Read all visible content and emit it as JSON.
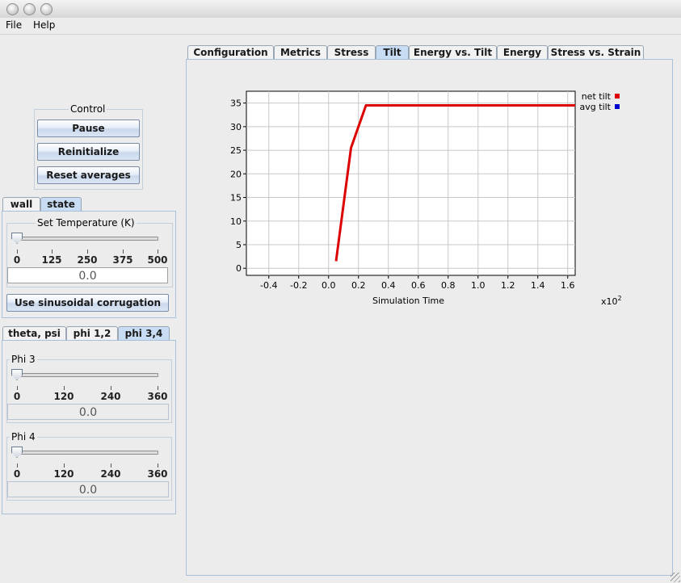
{
  "menu": [
    "File",
    "Help"
  ],
  "control": {
    "title": "Control",
    "pause": "Pause",
    "reinitialize": "Reinitialize",
    "reset_averages": "Reset averages"
  },
  "left_tabs": [
    "wall",
    "state"
  ],
  "state_panel": {
    "temp_title": "Set Temperature (K)",
    "temp_ticks": [
      "0",
      "125",
      "250",
      "375",
      "500"
    ],
    "temp_value": "0.0",
    "sinus_button": "Use sinusoidal corrugation"
  },
  "angle_tabs": [
    "theta, psi",
    "phi 1,2",
    "phi 3,4"
  ],
  "phi3": {
    "title": "Phi 3",
    "ticks": [
      "0",
      "120",
      "240",
      "360"
    ],
    "value": "0.0"
  },
  "phi4": {
    "title": "Phi 4",
    "ticks": [
      "0",
      "120",
      "240",
      "360"
    ],
    "value": "0.0"
  },
  "main_tabs": [
    "Configuration",
    "Metrics",
    "Stress",
    "Tilt",
    "Energy vs. Tilt",
    "Energy",
    "Stress vs. Strain"
  ],
  "chart_data": {
    "type": "line",
    "xlabel": "Simulation Time",
    "x_multiplier": "x10",
    "x_multiplier_exp": "2",
    "xlim": [
      -0.55,
      1.65
    ],
    "ylim": [
      -1.5,
      37.5
    ],
    "xticks": [
      -0.4,
      -0.2,
      0.0,
      0.2,
      0.4,
      0.6,
      0.8,
      1.0,
      1.2,
      1.4,
      1.6
    ],
    "xtick_labels": [
      "-0.4",
      "-0.2",
      "0.0",
      "0.2",
      "0.4",
      "0.6",
      "0.8",
      "1.0",
      "1.2",
      "1.4",
      "1.6"
    ],
    "yticks": [
      0,
      5,
      10,
      15,
      20,
      25,
      30,
      35
    ],
    "ytick_labels": [
      "0",
      "5",
      "10",
      "15",
      "20",
      "25",
      "30",
      "35"
    ],
    "grid": true,
    "legend_position": "top-right",
    "series": [
      {
        "name": "net tilt",
        "color": "#dd0000",
        "x": [
          0.05,
          0.15,
          0.25,
          0.3,
          1.65
        ],
        "y": [
          1.5,
          25.5,
          34.5,
          34.5,
          34.5
        ]
      },
      {
        "name": "avg tilt",
        "color": "#0000cc",
        "x": [],
        "y": []
      }
    ]
  }
}
